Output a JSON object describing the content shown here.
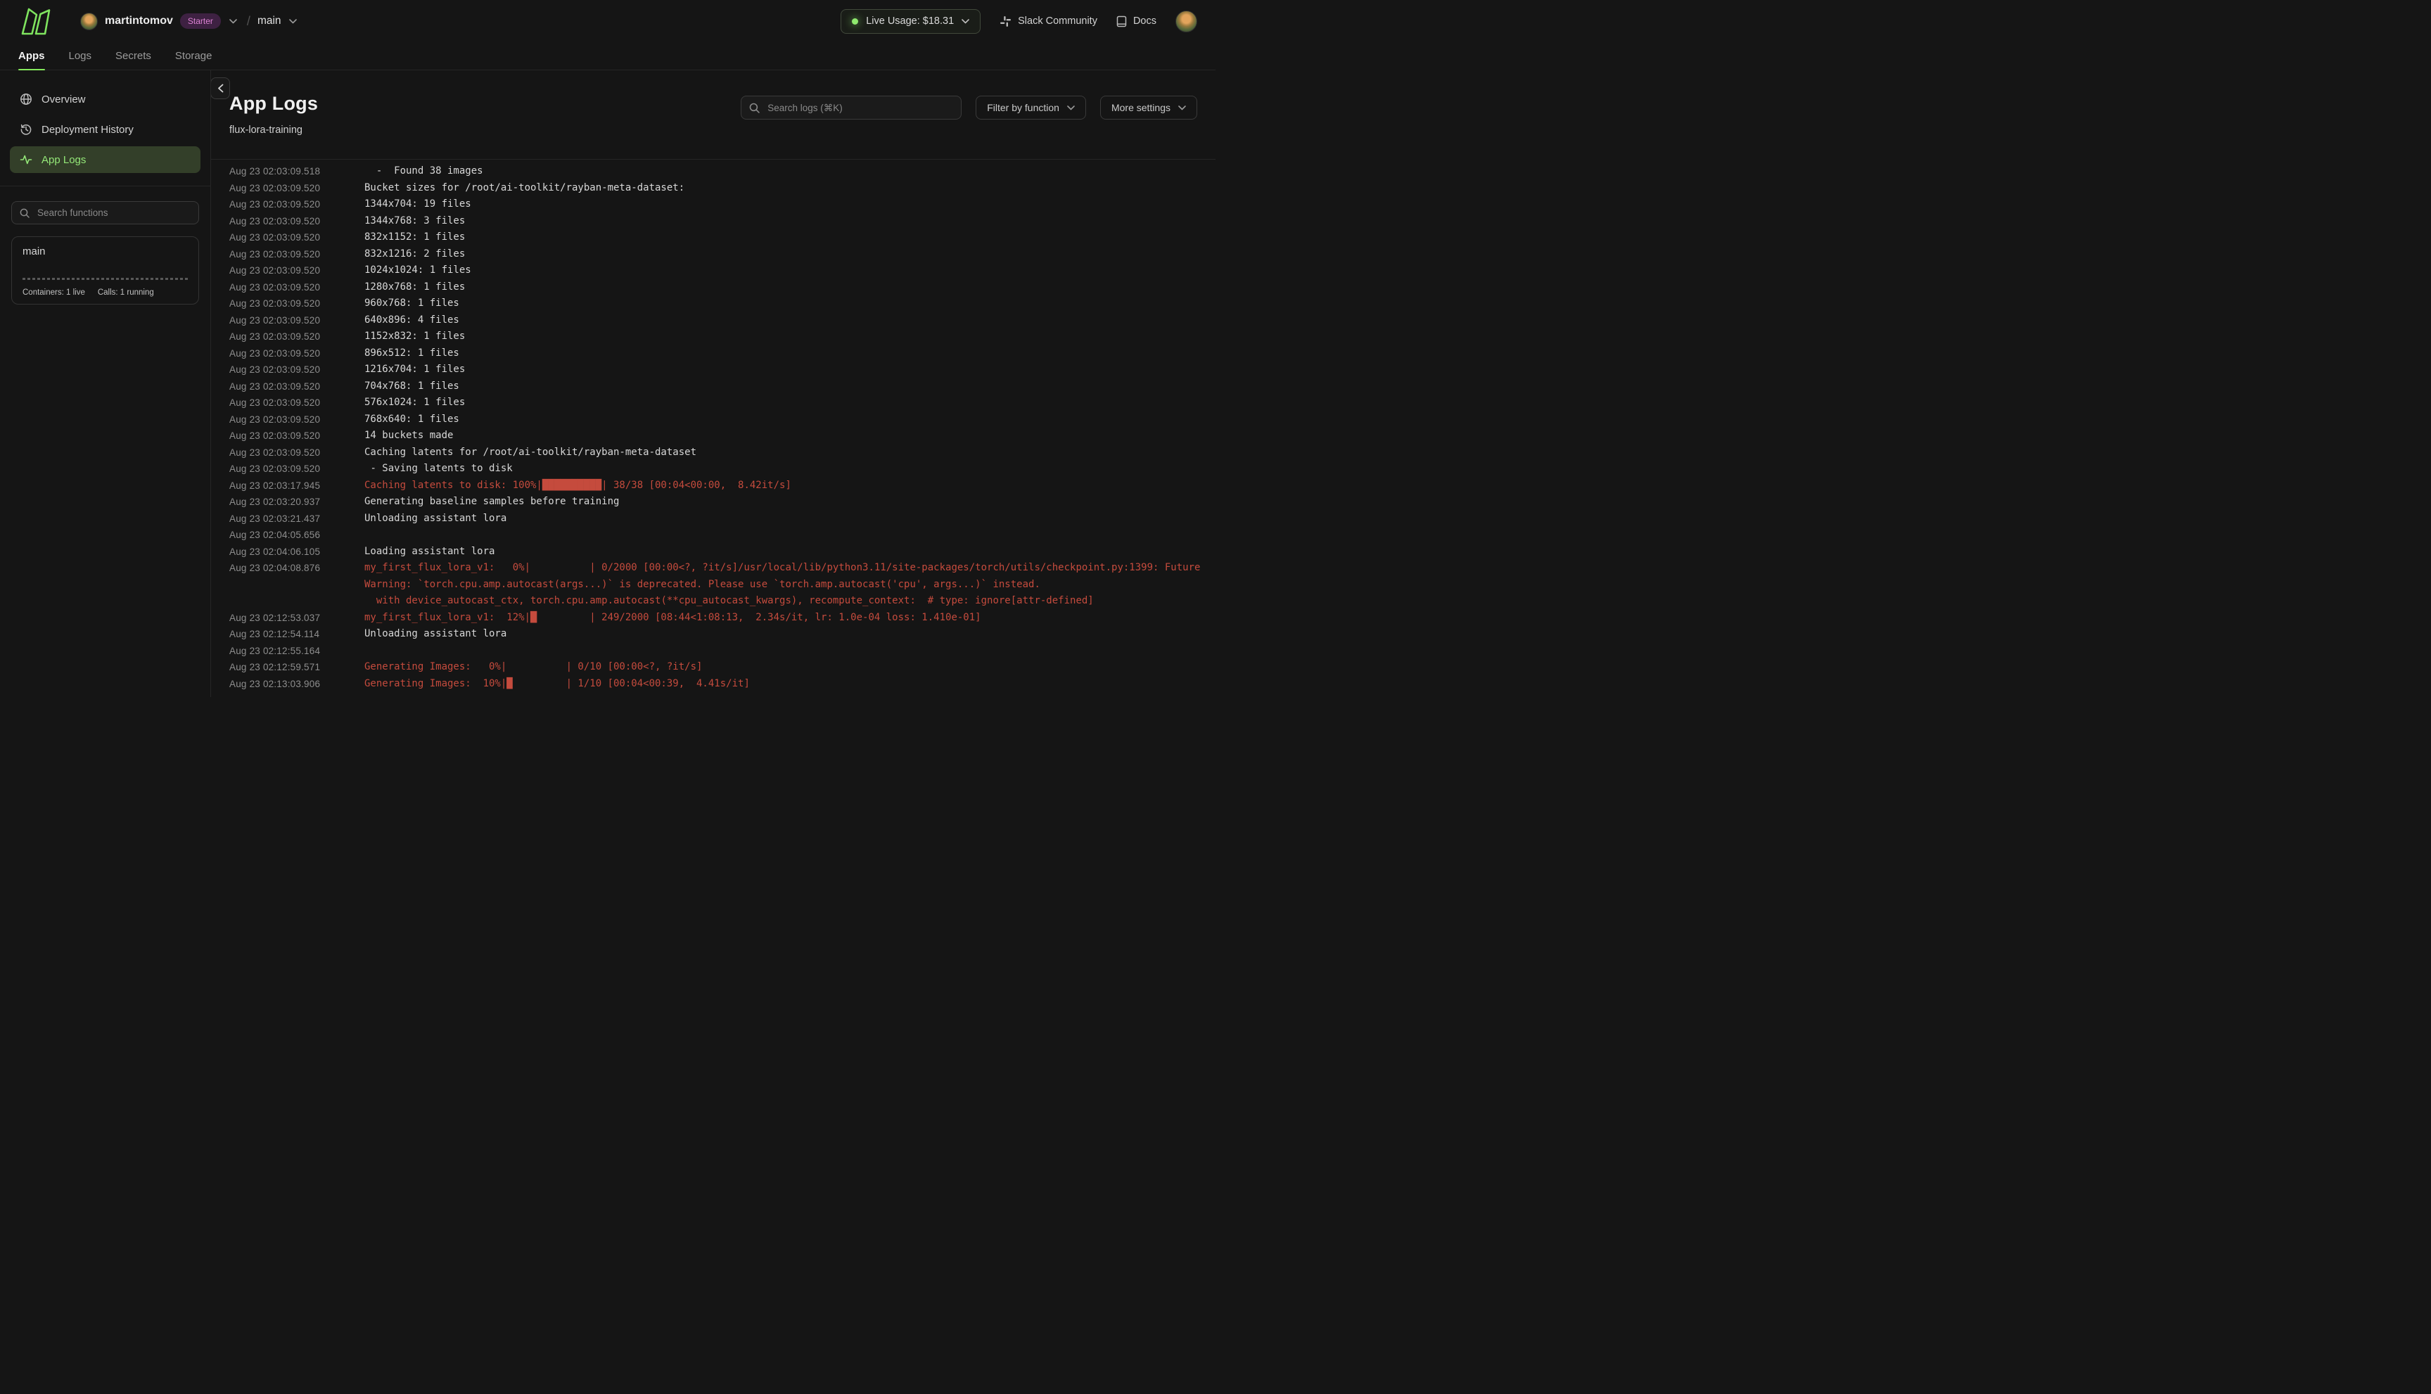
{
  "topbar": {
    "workspace": "martintomov",
    "plan_badge": "Starter",
    "breadcrumb_separator": "/",
    "environment": "main",
    "live_usage_label": "Live Usage: $18.31",
    "slack_label": "Slack Community",
    "docs_label": "Docs"
  },
  "tabs": [
    {
      "label": "Apps",
      "active": true
    },
    {
      "label": "Logs",
      "active": false
    },
    {
      "label": "Secrets",
      "active": false
    },
    {
      "label": "Storage",
      "active": false
    }
  ],
  "sidebar": {
    "nav": [
      {
        "label": "Overview",
        "icon": "globe-icon",
        "active": false
      },
      {
        "label": "Deployment History",
        "icon": "history-icon",
        "active": false
      },
      {
        "label": "App Logs",
        "icon": "pulse-icon",
        "active": true
      }
    ],
    "search_placeholder": "Search functions",
    "function_card": {
      "name": "main",
      "containers_stat": "Containers: 1 live",
      "calls_stat": "Calls: 1 running"
    }
  },
  "main": {
    "title": "App Logs",
    "app_name": "flux-lora-training",
    "search_placeholder": "Search logs (⌘K)",
    "filter_button_label": "Filter by function",
    "settings_button_label": "More settings",
    "logs": [
      {
        "ts": "Aug 23 02:03:09.518",
        "level": "info",
        "msg": "  -  Found 38 images"
      },
      {
        "ts": "Aug 23 02:03:09.520",
        "level": "info",
        "msg": "Bucket sizes for /root/ai-toolkit/rayban-meta-dataset:"
      },
      {
        "ts": "Aug 23 02:03:09.520",
        "level": "info",
        "msg": "1344x704: 19 files"
      },
      {
        "ts": "Aug 23 02:03:09.520",
        "level": "info",
        "msg": "1344x768: 3 files"
      },
      {
        "ts": "Aug 23 02:03:09.520",
        "level": "info",
        "msg": "832x1152: 1 files"
      },
      {
        "ts": "Aug 23 02:03:09.520",
        "level": "info",
        "msg": "832x1216: 2 files"
      },
      {
        "ts": "Aug 23 02:03:09.520",
        "level": "info",
        "msg": "1024x1024: 1 files"
      },
      {
        "ts": "Aug 23 02:03:09.520",
        "level": "info",
        "msg": "1280x768: 1 files"
      },
      {
        "ts": "Aug 23 02:03:09.520",
        "level": "info",
        "msg": "960x768: 1 files"
      },
      {
        "ts": "Aug 23 02:03:09.520",
        "level": "info",
        "msg": "640x896: 4 files"
      },
      {
        "ts": "Aug 23 02:03:09.520",
        "level": "info",
        "msg": "1152x832: 1 files"
      },
      {
        "ts": "Aug 23 02:03:09.520",
        "level": "info",
        "msg": "896x512: 1 files"
      },
      {
        "ts": "Aug 23 02:03:09.520",
        "level": "info",
        "msg": "1216x704: 1 files"
      },
      {
        "ts": "Aug 23 02:03:09.520",
        "level": "info",
        "msg": "704x768: 1 files"
      },
      {
        "ts": "Aug 23 02:03:09.520",
        "level": "info",
        "msg": "576x1024: 1 files"
      },
      {
        "ts": "Aug 23 02:03:09.520",
        "level": "info",
        "msg": "768x640: 1 files"
      },
      {
        "ts": "Aug 23 02:03:09.520",
        "level": "info",
        "msg": "14 buckets made"
      },
      {
        "ts": "Aug 23 02:03:09.520",
        "level": "info",
        "msg": "Caching latents for /root/ai-toolkit/rayban-meta-dataset"
      },
      {
        "ts": "Aug 23 02:03:09.520",
        "level": "info",
        "msg": " - Saving latents to disk"
      },
      {
        "ts": "Aug 23 02:03:17.945",
        "level": "error",
        "msg": "Caching latents to disk: 100%|██████████| 38/38 [00:04<00:00,  8.42it/s]"
      },
      {
        "ts": "Aug 23 02:03:20.937",
        "level": "info",
        "msg": "Generating baseline samples before training"
      },
      {
        "ts": "Aug 23 02:03:21.437",
        "level": "info",
        "msg": "Unloading assistant lora"
      },
      {
        "ts": "Aug 23 02:04:05.656",
        "level": "info",
        "msg": ""
      },
      {
        "ts": "Aug 23 02:04:06.105",
        "level": "info",
        "msg": "Loading assistant lora"
      },
      {
        "ts": "Aug 23 02:04:08.876",
        "level": "error",
        "msg": "my_first_flux_lora_v1:   0%|          | 0/2000 [00:00<?, ?it/s]/usr/local/lib/python3.11/site-packages/torch/utils/checkpoint.py:1399: FutureWarning: `torch.cpu.amp.autocast(args...)` is deprecated. Please use `torch.amp.autocast('cpu', args...)` instead.\n  with device_autocast_ctx, torch.cpu.amp.autocast(**cpu_autocast_kwargs), recompute_context:  # type: ignore[attr-defined]"
      },
      {
        "ts": "Aug 23 02:12:53.037",
        "level": "error",
        "msg": "my_first_flux_lora_v1:  12%|█▏        | 249/2000 [08:44<1:08:13,  2.34s/it, lr: 1.0e-04 loss: 1.410e-01]"
      },
      {
        "ts": "Aug 23 02:12:54.114",
        "level": "info",
        "msg": "Unloading assistant lora"
      },
      {
        "ts": "Aug 23 02:12:55.164",
        "level": "info",
        "msg": ""
      },
      {
        "ts": "Aug 23 02:12:59.571",
        "level": "error",
        "msg": "Generating Images:   0%|          | 0/10 [00:00<?, ?it/s]"
      },
      {
        "ts": "Aug 23 02:13:03.906",
        "level": "error",
        "msg": "Generating Images:  10%|█         | 1/10 [00:04<00:39,  4.41s/it]"
      }
    ]
  },
  "colors": {
    "background": "#151515",
    "accent_green": "#84e95c",
    "active_pill_bg": "#333f29",
    "active_pill_text": "#94e878",
    "error_red": "#c54b3d",
    "badge_bg": "#3e2142",
    "badge_text": "#dd82d4",
    "live_dot": "#8fe96e"
  }
}
